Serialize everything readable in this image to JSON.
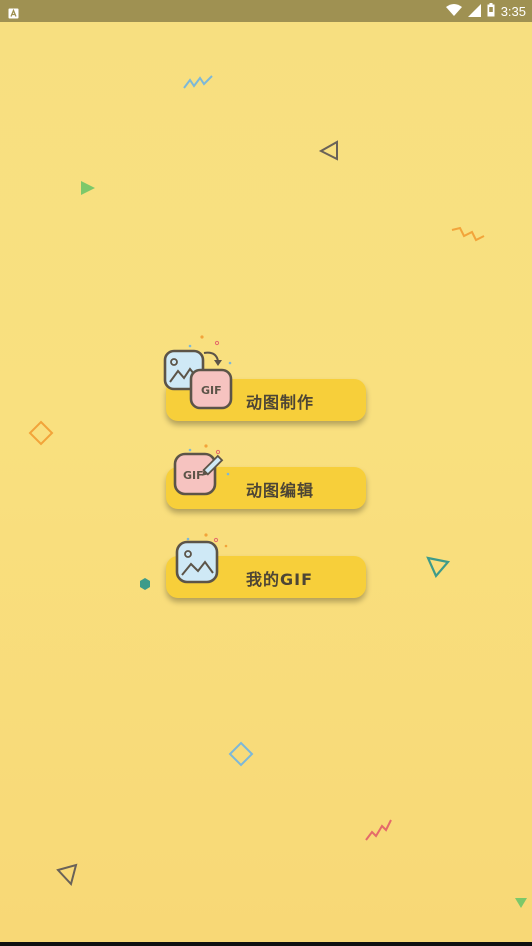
{
  "status_bar": {
    "time": "3:35",
    "colors": {
      "bar": "#9f9152",
      "icon": "#ffffff"
    },
    "icons": [
      "notification-icon",
      "wifi-icon",
      "signal-icon",
      "battery-icon"
    ]
  },
  "menu": {
    "items": [
      {
        "label": "动图制作",
        "icon": "image-to-gif-icon",
        "badge_text": "GIF"
      },
      {
        "label": "动图编辑",
        "icon": "gif-edit-icon",
        "badge_text": "GIF"
      },
      {
        "label": "我的GIF",
        "icon": "my-gallery-icon"
      }
    ]
  },
  "colors": {
    "background": "#f8de7e",
    "button": "#f7cf3a",
    "button_text": "#4d4535",
    "icon_blue": "#cfe9f6",
    "icon_pink": "#f6c3c0",
    "icon_outline": "#5c5448"
  }
}
